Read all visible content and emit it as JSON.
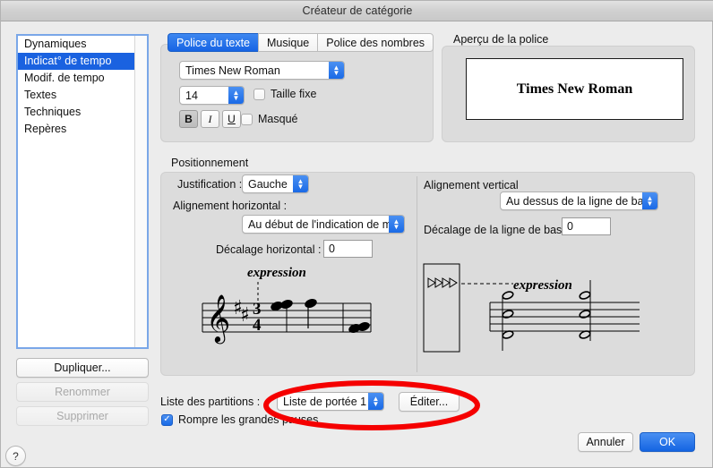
{
  "window": {
    "title": "Créateur de catégorie"
  },
  "sidebar": {
    "items": [
      {
        "label": "Dynamiques",
        "selected": false
      },
      {
        "label": "Indicat° de tempo",
        "selected": true
      },
      {
        "label": "Modif. de tempo",
        "selected": false
      },
      {
        "label": "Textes",
        "selected": false
      },
      {
        "label": "Techniques",
        "selected": false
      },
      {
        "label": "Repères",
        "selected": false
      }
    ],
    "buttons": {
      "duplicate": "Dupliquer...",
      "rename": "Renommer",
      "delete": "Supprimer"
    }
  },
  "tabs": [
    {
      "label": "Police du texte",
      "active": true
    },
    {
      "label": "Musique",
      "active": false
    },
    {
      "label": "Police des nombres",
      "active": false
    }
  ],
  "font_panel": {
    "font_family_value": "Times New Roman",
    "font_size_value": "14",
    "fixed_size_label": "Taille fixe",
    "fixed_size_checked": false,
    "hidden_label": "Masqué",
    "hidden_checked": false,
    "bold_label": "B",
    "italic_label": "I",
    "underline_label": "U",
    "bold_active": true,
    "italic_active": false,
    "underline_active": false
  },
  "preview": {
    "group_label": "Aperçu de la police",
    "sample_text": "Times New Roman"
  },
  "positioning": {
    "group_label": "Positionnement",
    "justification_label": "Justification :",
    "justification_value": "Gauche",
    "h_align_label": "Alignement horizontal :",
    "h_align_value": "Au début de l'indication de m...",
    "h_offset_label": "Décalage horizontal :",
    "h_offset_value": "0",
    "v_align_label": "Alignement vertical",
    "v_align_value": "Au dessus de la ligne de bas...",
    "v_offset_label": "Décalage de la ligne de bas",
    "v_offset_value": "0",
    "expression_text_left": "expression",
    "expression_text_right": "expression"
  },
  "bottom": {
    "score_list_label": "Liste des partitions :",
    "score_list_value": "Liste de portée 1",
    "edit_button": "Éditer...",
    "break_rests_label": "Rompre les grandes pauses",
    "break_rests_checked": true,
    "cancel_button": "Annuler",
    "ok_button": "OK",
    "help_button": "?"
  },
  "annotation": {
    "color": "#f50000",
    "shape": "ellipse"
  },
  "colors": {
    "accent_blue": "#1a6ae6",
    "selection_blue": "#1a62e0",
    "window_bg": "#ececec",
    "group_bg": "#dcdcdc",
    "annotation_red": "#f50000"
  },
  "icons": {
    "stepper": "stepper-arrows-icon",
    "popup_arrows": "popup-arrows-icon",
    "checkmark": "checkmark-icon",
    "help": "question-mark-icon"
  }
}
